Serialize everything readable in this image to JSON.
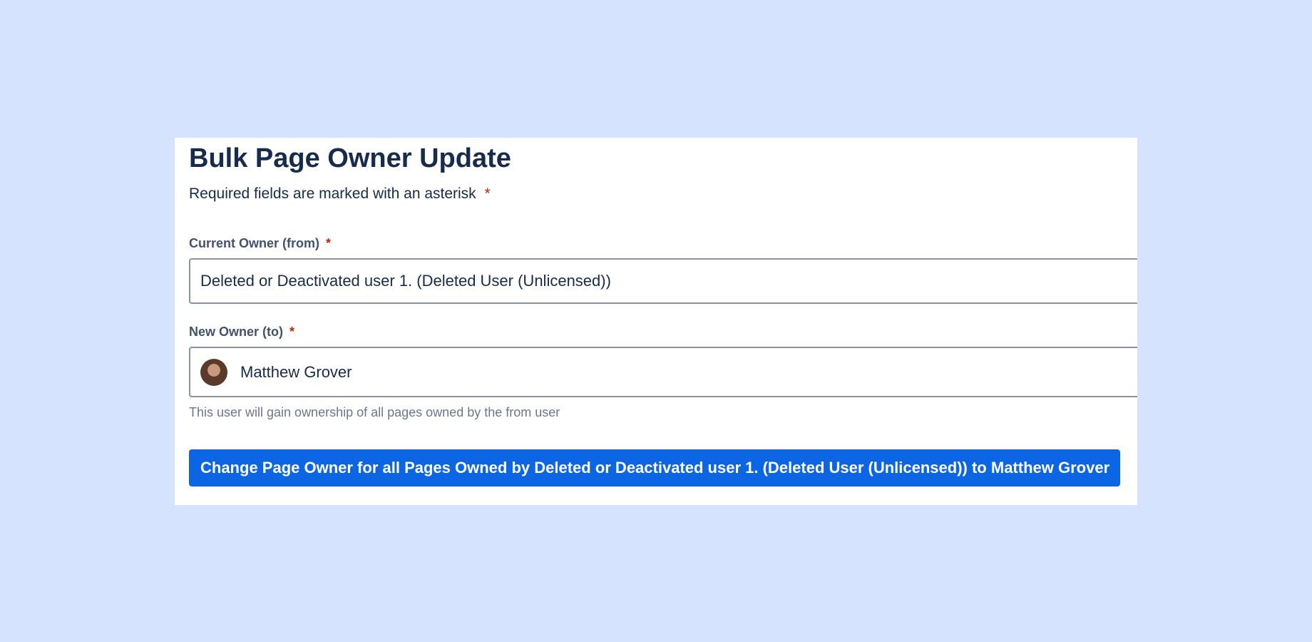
{
  "page": {
    "title": "Bulk Page Owner Update",
    "required_note": "Required fields are marked with an asterisk",
    "required_star": "*"
  },
  "form": {
    "from": {
      "label": "Current Owner (from)",
      "star": "*",
      "value": "Deleted or Deactivated user 1. (Deleted User (Unlicensed))"
    },
    "to": {
      "label": "New Owner (to)",
      "star": "*",
      "value": "Matthew Grover",
      "avatar": "user-avatar",
      "helper": "This user will gain ownership of all pages owned by the from user"
    },
    "submit_label": "Change Page Owner for all Pages Owned by Deleted or Deactivated user 1. (Deleted User (Unlicensed)) to Matthew Grover"
  },
  "colors": {
    "background": "#d5e3ff",
    "primary": "#0c66e4",
    "required": "#bf2600",
    "text": "#172b4d"
  }
}
